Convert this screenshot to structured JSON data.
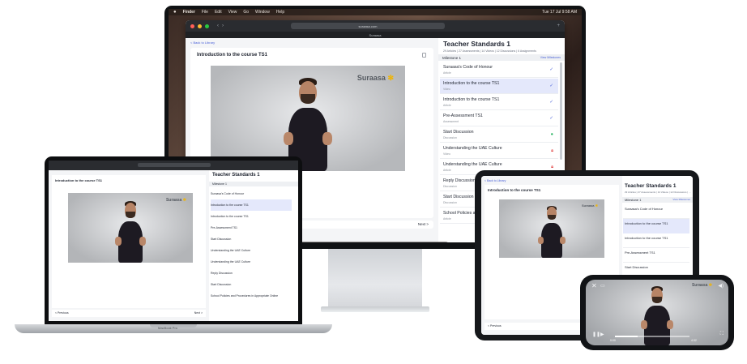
{
  "imac": {
    "menubar": {
      "apple": "",
      "items": [
        "Finder",
        "File",
        "Edit",
        "View",
        "Go",
        "Window",
        "Help"
      ],
      "clock": "Tue 17 Jul 9:58 AM"
    },
    "browser": {
      "url": "suraasa.com",
      "tab_title": "Suraasa",
      "back_link": "< Back to Library",
      "lesson_title": "Introduction to the course TS1",
      "brand": "Suraasa",
      "next_button": "Next >",
      "sidebar": {
        "course_title": "Teacher Standards 1",
        "course_subtitle": "29 Articles | 27 Assessments | 14 Videos | 12 Discussions | 6 Assignments",
        "milestone": "Milestone 1",
        "view_milestones": "View Milestones",
        "lessons": [
          {
            "title": "Suraasa's Code of Honour",
            "type": "Article",
            "status": "done"
          },
          {
            "title": "Introduction to the course TS1",
            "type": "Video",
            "status": "done"
          },
          {
            "title": "Introduction to the course TS1",
            "type": "Article",
            "status": "done"
          },
          {
            "title": "Pre-Assessment TS1",
            "type": "Assessment",
            "status": "done"
          },
          {
            "title": "Start Discussion",
            "type": "Discussion",
            "status": "dot"
          },
          {
            "title": "Understanding the UAE Culture",
            "type": "Video",
            "status": "locked"
          },
          {
            "title": "Understanding the UAE Culture",
            "type": "Article",
            "status": "locked"
          },
          {
            "title": "Reply Discussion",
            "type": "Discussion",
            "status": "locked"
          },
          {
            "title": "Start Discussion",
            "type": "Discussion",
            "status": "locked"
          },
          {
            "title": "School Policies and Procedures in Appropriate Online",
            "type": "Article",
            "status": "locked"
          }
        ]
      }
    }
  },
  "macbook": {
    "label": "MacBook Pro",
    "previous_button": "< Previous",
    "next_button": "Next >"
  },
  "ipad": {
    "previous_button": "< Previous"
  },
  "iphone": {
    "brand": "Suraasa",
    "time_current": "0:00",
    "time_total": "4:32"
  },
  "colors": {
    "accent": "#4b62d8",
    "active_row": "#e4e8fb",
    "done": "#4b62d8",
    "dot": "#1fb05a",
    "locked": "#e24b4b",
    "brand_leaf": "#f0b400"
  }
}
